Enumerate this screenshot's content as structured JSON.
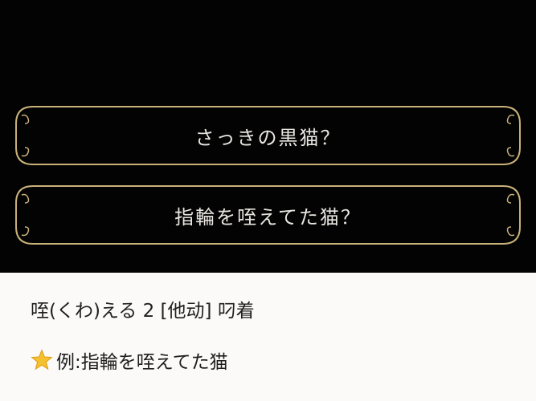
{
  "game": {
    "choices": [
      {
        "label": "さっきの黒猫？"
      },
      {
        "label": "指輪を咥えてた猫？"
      }
    ],
    "frame_color": "#c9b27a"
  },
  "caption": {
    "line1": "咥(くわ)える 2 [他动]  叼着",
    "line2_icon": "star-icon",
    "line2_text": "例:指輪を咥えてた猫"
  }
}
